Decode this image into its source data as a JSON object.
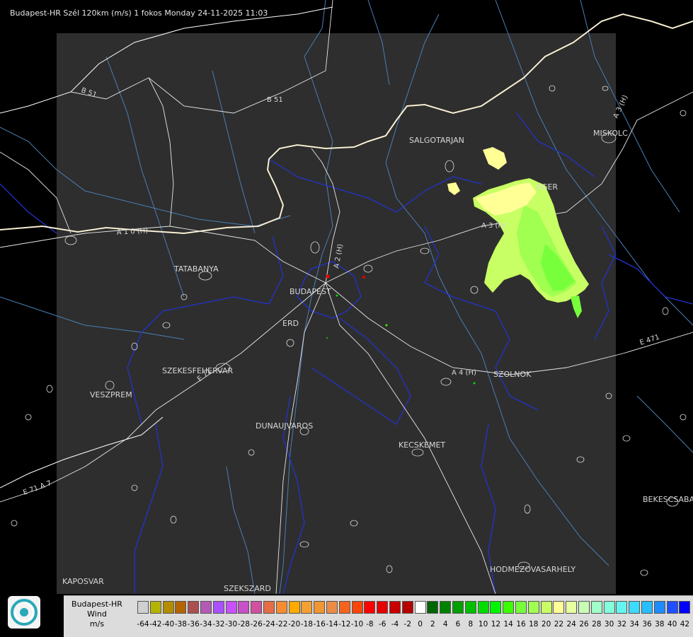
{
  "title": "Budapest-HR Szél 120km (m/s) 1 fokos Monday 24-11-2025 11:03",
  "places": {
    "salgotarjan": "SALGOTARJAN",
    "miskolc": "MISKOLC",
    "eger": "EGER",
    "tatabanya": "TATABANYA",
    "budapest": "BUDAPEST",
    "erd": "ERD",
    "szekesfehervar": "SZEKESFEHERVAR",
    "veszprem": "VESZPREM",
    "dunaujvaros": "DUNAUJVAROS",
    "kecskemet": "KECSKEMET",
    "szolnok": "SZOLNOK",
    "bekescsaba": "BEKESCSABA",
    "hodmezovasarhely": "HODMEZOVASARHELY",
    "kaposvar": "KAPOSVAR",
    "szekszard": "SZEKSZARD"
  },
  "roads": {
    "b51_west": "B 51",
    "b51_east": "B 51",
    "a1": "A 1 0 (H)",
    "a2": "A 2 (H)",
    "a3": "A 3 (H)",
    "a3_east": "A 3 (H)",
    "a4": "A 4 (H)",
    "e71": "E 71",
    "e71_sw": "E 71 A 7",
    "e471": "E 471"
  },
  "legend": {
    "title_line1": "Budapest-HR",
    "title_line2": "Wind",
    "title_line3": "m/s",
    "colors": [
      "#d0d0d0",
      "#b4b400",
      "#b48c00",
      "#b46400",
      "#aa5050",
      "#b45ab4",
      "#aa50ff",
      "#c850ff",
      "#c850c8",
      "#d250a0",
      "#e66e46",
      "#f58c32",
      "#ffaa00",
      "#f5a032",
      "#f09632",
      "#eb8c46",
      "#f5641e",
      "#fa460a",
      "#ff0000",
      "#e60000",
      "#c80000",
      "#b40000",
      "#ffffff",
      "#006400",
      "#008200",
      "#00a000",
      "#00be00",
      "#00dc00",
      "#00f500",
      "#3cff00",
      "#78ff3c",
      "#a0ff50",
      "#c8ff64",
      "#ffff96",
      "#e6ffa0",
      "#c8ffb4",
      "#a0ffc8",
      "#82ffdc",
      "#64f5f0",
      "#3cdcff",
      "#28beff",
      "#1e8cff",
      "#1e50ff",
      "#0000ff"
    ],
    "ticks": [
      "-64",
      "-42",
      "-40",
      "-38",
      "-36",
      "-34",
      "-32",
      "-30",
      "-28",
      "-26",
      "-24",
      "-22",
      "-20",
      "-18",
      "-16",
      "-14",
      "-12",
      "-10",
      "-8",
      "-6",
      "-4",
      "-2",
      "0",
      "2",
      "4",
      "6",
      "8",
      "10",
      "12",
      "14",
      "16",
      "18",
      "20",
      "22",
      "24",
      "26",
      "28",
      "30",
      "32",
      "34",
      "36",
      "38",
      "40",
      "42"
    ]
  }
}
